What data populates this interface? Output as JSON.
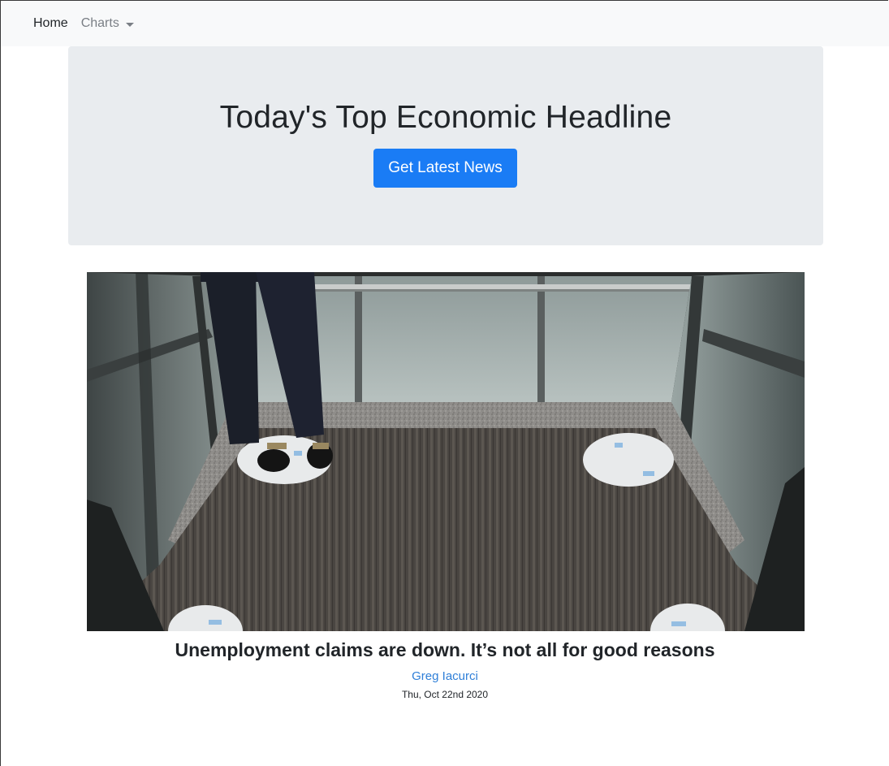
{
  "navbar": {
    "home_label": "Home",
    "charts_label": "Charts"
  },
  "jumbotron": {
    "title": "Today's Top Economic Headline",
    "button_label": "Get Latest News"
  },
  "article": {
    "image_icon": "elevator-photo",
    "headline": "Unemployment claims are down. It’s not all for good reasons",
    "author": "Greg Iacurci",
    "date": "Thu, Oct 22nd 2020"
  },
  "colors": {
    "navbar_bg": "#f8f9fa",
    "jumbotron_bg": "#e9ecef",
    "primary": "#1a7cf5",
    "link": "#2f7fd8"
  }
}
